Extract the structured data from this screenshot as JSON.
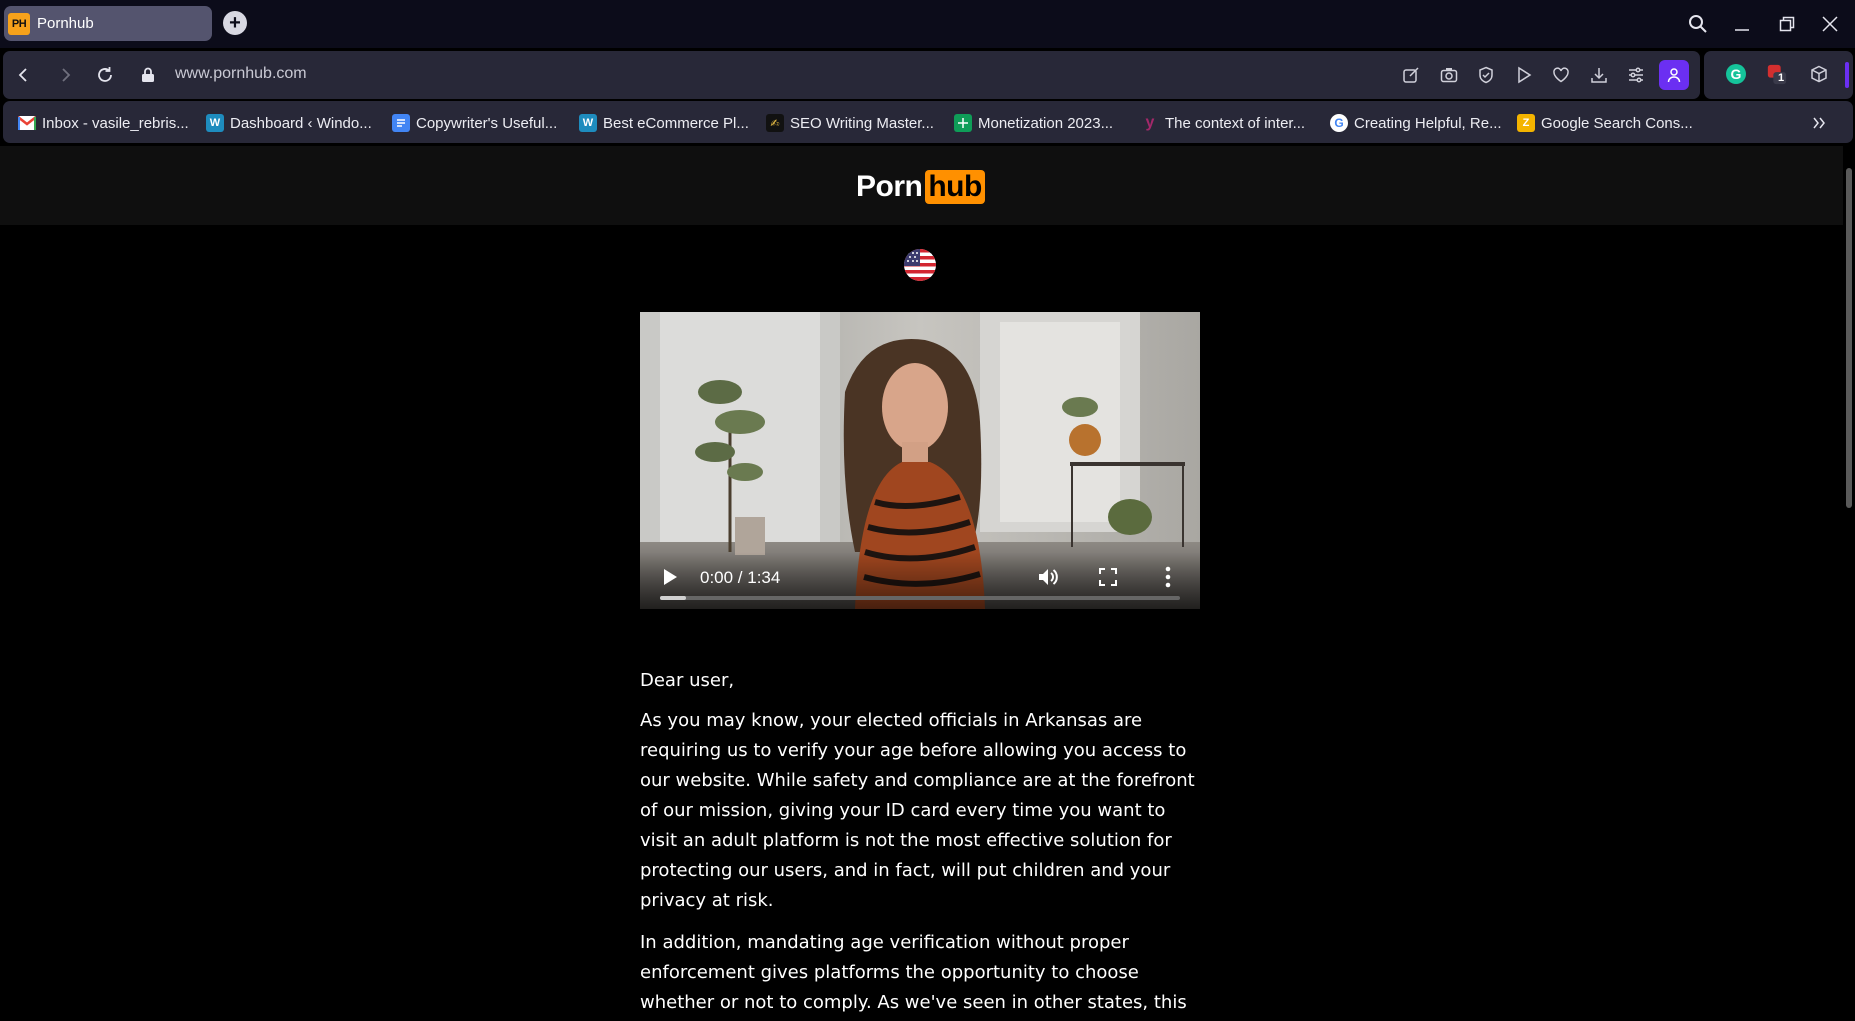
{
  "browser": {
    "tab": {
      "favicon_text": "PH",
      "title": "Pornhub"
    },
    "new_tab_label": "+",
    "url": "www.pornhub.com",
    "extension_badge": "1"
  },
  "bookmarks": [
    {
      "label": "Inbox - vasile_rebris...",
      "icon": "gmail-icon",
      "color": "#ea4335"
    },
    {
      "label": "Dashboard ‹ Windo...",
      "icon": "wordpress-icon",
      "color": "#1e8cbe"
    },
    {
      "label": "Copywriter's Useful...",
      "icon": "google-docs-icon",
      "color": "#4285f4"
    },
    {
      "label": "Best eCommerce Pl...",
      "icon": "wordpress-icon",
      "color": "#1e8cbe"
    },
    {
      "label": "SEO Writing Master...",
      "icon": "seo-icon",
      "color": "#1a1a1a"
    },
    {
      "label": "Monetization 2023...",
      "icon": "google-sheets-icon",
      "color": "#0f9d58"
    },
    {
      "label": "The context of inter...",
      "icon": "yoast-icon",
      "color": "#a4286a"
    },
    {
      "label": "Creating Helpful, Re...",
      "icon": "google-icon",
      "color": "#ffffff"
    },
    {
      "label": "Google Search Cons...",
      "icon": "search-console-icon",
      "color": "#f4b400"
    }
  ],
  "site": {
    "logo_left": "Porn",
    "logo_right": "hub",
    "accent_color": "#ff9000"
  },
  "video": {
    "time": "0:00 / 1:34",
    "progress": 0.05
  },
  "letter": {
    "greeting": "Dear user,",
    "paragraph1": "As you may know, your elected officials in Arkansas are requiring us to verify your age before allowing you access to our website. While safety and compliance are at the forefront of our mission, giving your ID card every time you want to visit an adult platform is not the most effective solution for protecting our users, and in fact, will put children and your privacy at risk.",
    "paragraph2": "In addition, mandating age verification without proper enforcement gives platforms the opportunity to choose whether or not to comply. As we've seen in other states, this"
  }
}
